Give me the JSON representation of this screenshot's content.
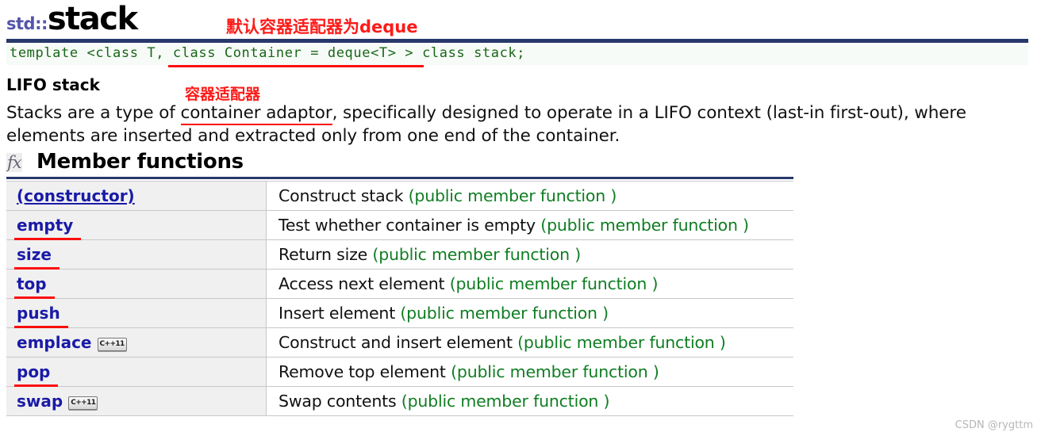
{
  "header": {
    "namespace": "std::",
    "name": "stack",
    "annotation_deque": "默认容器适配器为deque"
  },
  "prototype": {
    "text": "template <class T, class Container = deque<T> > class stack;",
    "highlighted_part": "class Container = deque<T> >"
  },
  "summary": {
    "heading": "LIFO stack",
    "annotation_adaptor": "容器适配器",
    "paragraph_before": "Stacks are a type of ",
    "paragraph_link": "container adaptor",
    "paragraph_after": ", specifically designed to operate in a LIFO context (last-in first-out), where elements are inserted and extracted only from one end of the container."
  },
  "member_functions": {
    "icon": "fx-icon",
    "icon_text": "fx",
    "title": "Member functions",
    "rows": [
      {
        "name": "(constructor)",
        "underline": "link",
        "badge": "",
        "desc": "Construct stack",
        "kind": "(public member function )"
      },
      {
        "name": "empty",
        "underline": "red",
        "badge": "",
        "desc": "Test whether container is empty",
        "kind": "(public member function )"
      },
      {
        "name": "size",
        "underline": "red",
        "badge": "",
        "desc": "Return size",
        "kind": "(public member function )"
      },
      {
        "name": "top",
        "underline": "red",
        "badge": "",
        "desc": "Access next element",
        "kind": "(public member function )"
      },
      {
        "name": "push",
        "underline": "red",
        "badge": "",
        "desc": "Insert element",
        "kind": "(public member function )"
      },
      {
        "name": "emplace",
        "underline": "none",
        "badge": "C++11",
        "desc": "Construct and insert element",
        "kind": "(public member function )"
      },
      {
        "name": "pop",
        "underline": "red",
        "badge": "",
        "desc": "Remove top element",
        "kind": "(public member function )"
      },
      {
        "name": "swap",
        "underline": "none",
        "badge": "C++11",
        "desc": "Swap contents",
        "kind": "(public member function )"
      }
    ]
  },
  "watermark": "CSDN @rygttm",
  "colors": {
    "accent_rule": "#27396b",
    "annotation_red": "#fc1b18",
    "link_blue": "#1a1aa8",
    "code_green": "#196619",
    "kind_green": "#0f7d22",
    "namespace_blue": "#5555aa"
  }
}
